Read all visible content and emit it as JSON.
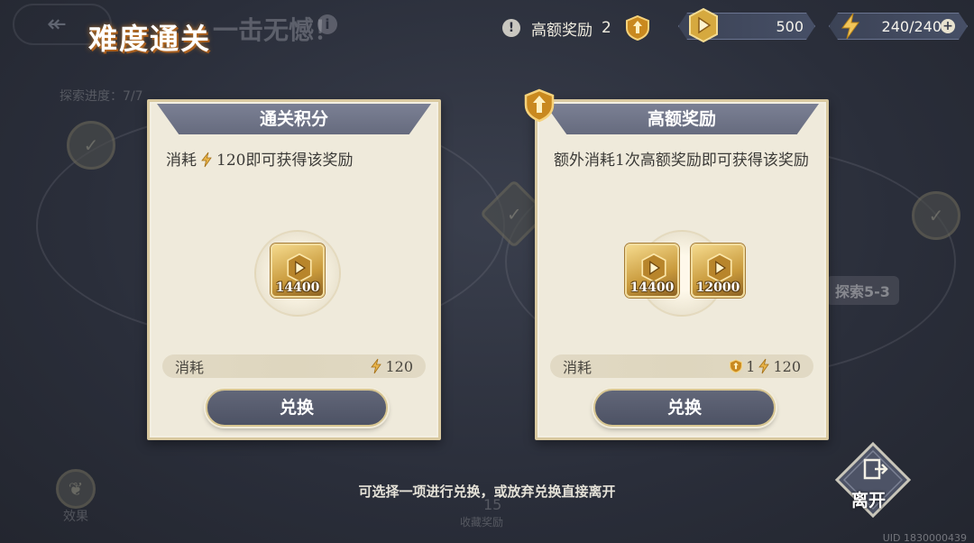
{
  "header": {
    "title": "难度通关",
    "bg_title": "一击无憾！",
    "explore_progress": "探索进度：7/7"
  },
  "status": {
    "high_reward_label": "高额奖励",
    "high_reward_count": "2",
    "coins": "500",
    "energy": "240/240"
  },
  "cards": {
    "left": {
      "title": "通关积分",
      "desc_prefix": "消耗",
      "desc_suffix": "120即可获得该奖励",
      "rewards": [
        {
          "amount": "14400"
        }
      ],
      "cost_label": "消耗",
      "cost_energy": "120",
      "button": "兑换"
    },
    "right": {
      "title": "高额奖励",
      "desc": "额外消耗1次高额奖励即可获得该奖励",
      "rewards": [
        {
          "amount": "14400"
        },
        {
          "amount": "12000"
        }
      ],
      "cost_label": "消耗",
      "cost_badge": "1",
      "cost_energy": "120",
      "button": "兑换"
    }
  },
  "background": {
    "stage_label": "探索5-3",
    "effect_label": "效果",
    "bottom_num": "15",
    "bottom_sub": "收藏奖励"
  },
  "footer": {
    "hint": "可选择一项进行兑换，或放弃兑换直接离开",
    "leave": "离开",
    "uid": "UID 1830000439"
  },
  "colors": {
    "accent_gold": "#d7b15a",
    "card_bg": "#efeadb",
    "button_bg": "#565b6d"
  }
}
